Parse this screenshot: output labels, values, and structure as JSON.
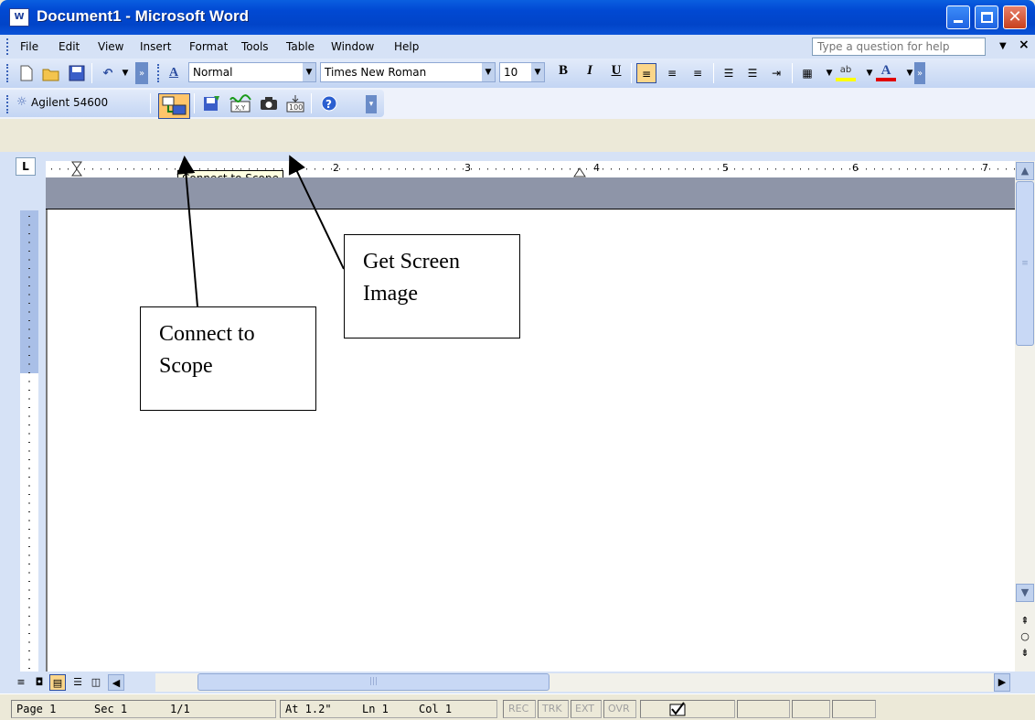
{
  "window": {
    "title": "Document1 - Microsoft Word",
    "app_icon": "W"
  },
  "menu": {
    "items": [
      "File",
      "Edit",
      "View",
      "Insert",
      "Format",
      "Tools",
      "Table",
      "Window",
      "Help"
    ],
    "help_placeholder": "Type a question for help"
  },
  "toolbar": {
    "style": "Normal",
    "font": "Times New Roman",
    "size": "10",
    "bold": "B",
    "italic": "I",
    "underline": "U"
  },
  "agilent_toolbar": {
    "label": "Agilent 54600"
  },
  "tooltip": "Connect to Scope",
  "ruler": {
    "numbers": [
      "2",
      "3",
      "4",
      "5",
      "6",
      "7"
    ]
  },
  "callouts": {
    "connect": [
      "Connect to",
      "Scope"
    ],
    "screen": [
      "Get Screen",
      "Image"
    ]
  },
  "status": {
    "page": "Page 1",
    "sec": "Sec 1",
    "pages": "1/1",
    "at": "At 1.2\"",
    "ln": "Ln 1",
    "col": "Col 1",
    "modes": [
      "REC",
      "TRK",
      "EXT",
      "OVR"
    ]
  },
  "colors": {
    "titlebar": "#0149d3",
    "toolbar": "#c1d2ee",
    "active_button": "#fbd68a"
  }
}
